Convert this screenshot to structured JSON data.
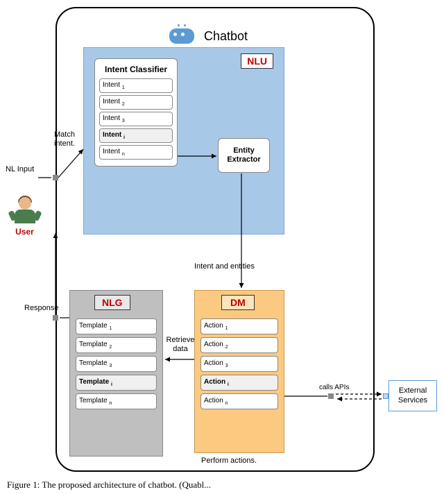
{
  "header": {
    "title": "Chatbot"
  },
  "nlu": {
    "label": "NLU",
    "intent_classifier": {
      "title": "Intent Classifier",
      "items": [
        {
          "base": "Intent",
          "sub": "1",
          "selected": false
        },
        {
          "base": "Intent",
          "sub": "2",
          "selected": false
        },
        {
          "base": "Intent",
          "sub": "3",
          "selected": false
        },
        {
          "base": "Intent",
          "sub": "i",
          "selected": true
        },
        {
          "base": "Intent",
          "sub": "n",
          "selected": false
        }
      ]
    },
    "entity_extractor": {
      "title": "Entity Extractor"
    }
  },
  "nlg": {
    "label": "NLG",
    "templates": [
      {
        "base": "Template",
        "sub": "1",
        "selected": false
      },
      {
        "base": "Template",
        "sub": "2",
        "selected": false
      },
      {
        "base": "Template",
        "sub": "3",
        "selected": false
      },
      {
        "base": "Template",
        "sub": "i",
        "selected": true
      },
      {
        "base": "Template",
        "sub": "n",
        "selected": false
      }
    ]
  },
  "dm": {
    "label": "DM",
    "actions": [
      {
        "base": "Action",
        "sub": "1",
        "selected": false
      },
      {
        "base": "Action",
        "sub": "2",
        "selected": false
      },
      {
        "base": "Action",
        "sub": "3",
        "selected": false
      },
      {
        "base": "Action",
        "sub": "i",
        "selected": true
      },
      {
        "base": "Action",
        "sub": "n",
        "selected": false
      }
    ],
    "footer": "Perform actions."
  },
  "user": {
    "label": "User"
  },
  "external": {
    "label": "External Services"
  },
  "edges": {
    "nl_input": "NL Input",
    "match_intent": "Match intent.",
    "intent_entities": "Intent and entities",
    "retrieve_data": "Retrieve data",
    "response": "Response",
    "calls_apis": "calls APIs"
  },
  "caption": "Figure 1:  The   proposed   architecture   of  chatbot.   (Quabl..."
}
